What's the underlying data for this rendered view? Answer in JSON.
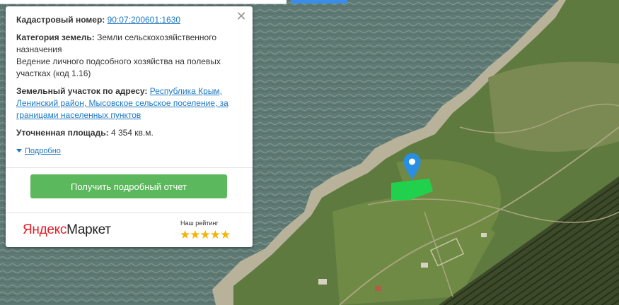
{
  "popup": {
    "close_icon": "close-icon",
    "cadastral": {
      "label": "Кадастровый номер:",
      "value": "90:07:200601:1630"
    },
    "category": {
      "label": "Категория земель:",
      "value": "Земли сельскохозяйственного назначения",
      "usage": "Ведение личного подсобного хозяйства на полевых участках (код 1.16)"
    },
    "address": {
      "label": "Земельный участок по адресу:",
      "value": "Республика Крым, Ленинский район, Мысовское сельское поселение, за границами населенных пунктов"
    },
    "area": {
      "label": "Уточненная площадь:",
      "value": "4 354 кв.м."
    },
    "details_link": "Подробно",
    "report_button": "Получить подробный отчет",
    "footer": {
      "logo_part1": "Яндекс",
      "logo_part2": "Маркет",
      "rating_label": "Наш рейтинг",
      "stars_text": "★★★★★",
      "star_color": "#f5b400"
    }
  },
  "map": {
    "marker_icon": "map-marker-icon",
    "parcel_color": "#21d14e",
    "marker_color": "#2a8fe0"
  }
}
